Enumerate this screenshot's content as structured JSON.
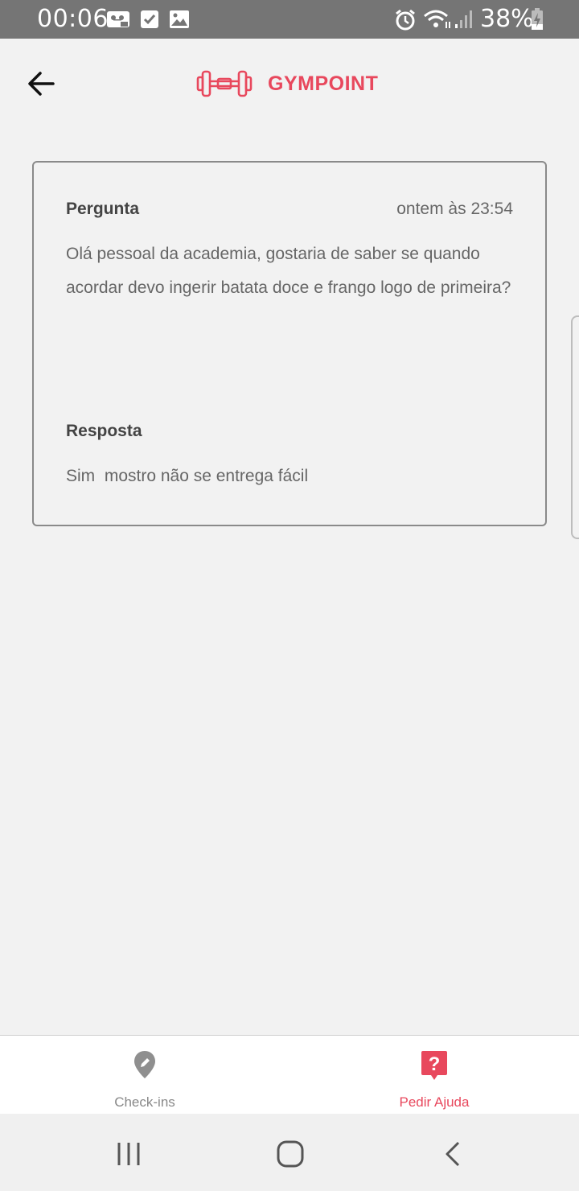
{
  "status_bar": {
    "time": "00:06",
    "battery": "38%",
    "icons": [
      "voicemail-icon",
      "checkbox-icon",
      "image-icon",
      "alarm-icon",
      "wifi-icon",
      "signal-icon",
      "battery-charging-icon"
    ]
  },
  "header": {
    "back_icon": "arrow-left-icon",
    "brand_icon": "dumbbell-icon",
    "brand_name": "GYMPOINT",
    "brand_color": "#e8485d"
  },
  "question": {
    "title": "Pergunta",
    "time": "ontem às 23:54",
    "text": "Olá pessoal da academia, gostaria de saber se quando acordar devo ingerir batata doce e frango logo de primeira?"
  },
  "answer": {
    "title": "Resposta",
    "text": "Sim  mostro não se entrega fácil"
  },
  "tabs": [
    {
      "label": "Check-ins",
      "icon": "map-pin-icon",
      "active": false
    },
    {
      "label": "Pedir Ajuda",
      "icon": "help-bubble-icon",
      "active": true
    }
  ],
  "nav": {
    "icons": [
      "recents-icon",
      "home-icon",
      "back-icon"
    ]
  }
}
